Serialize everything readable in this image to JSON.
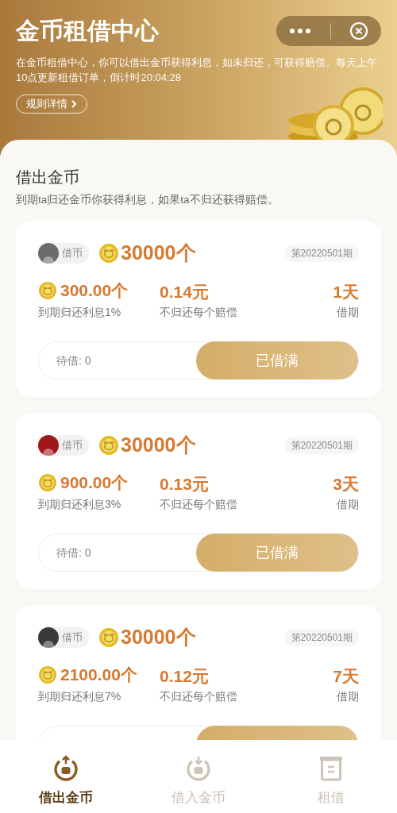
{
  "header": {
    "title": "金币租借中心",
    "description": "在金币租借中心，你可以借出金币获得利息，如未归还，可获得赔偿。每天上午10点更新租借订单，倒计时20:04:28",
    "rules_button": "规则详情"
  },
  "section": {
    "title": "借出金币",
    "subtitle": "到期ta归还金币你获得利息，如果ta不归还获得赔偿。"
  },
  "cards": [
    {
      "color": "#6b6b6b",
      "tag": "借币",
      "amount": "30000个",
      "period": "第20220501期",
      "interest": "300.00个",
      "interest_label": "到期归还利息1%",
      "compensation": "0.14元",
      "compensation_label": "不归还每个赔偿",
      "term": "1天",
      "term_label": "借期",
      "pending": "待借: 0",
      "button": "已借满"
    },
    {
      "color": "#a3161a",
      "tag": "借币",
      "amount": "30000个",
      "period": "第20220501期",
      "interest": "900.00个",
      "interest_label": "到期归还利息3%",
      "compensation": "0.13元",
      "compensation_label": "不归还每个赔偿",
      "term": "3天",
      "term_label": "借期",
      "pending": "待借: 0",
      "button": "已借满"
    },
    {
      "color": "#3a3a3a",
      "tag": "借币",
      "amount": "30000个",
      "period": "第20220501期",
      "interest": "2100.00个",
      "interest_label": "到期归还利息7%",
      "compensation": "0.12元",
      "compensation_label": "不归还每个赔偿",
      "term": "7天",
      "term_label": "借期"
    }
  ],
  "tabs": [
    {
      "label": "借出金币",
      "selected": true,
      "kind": "lend"
    },
    {
      "label": "借入金币",
      "selected": false,
      "kind": "borrow"
    },
    {
      "label": "租借",
      "selected": false,
      "kind": "records"
    }
  ]
}
